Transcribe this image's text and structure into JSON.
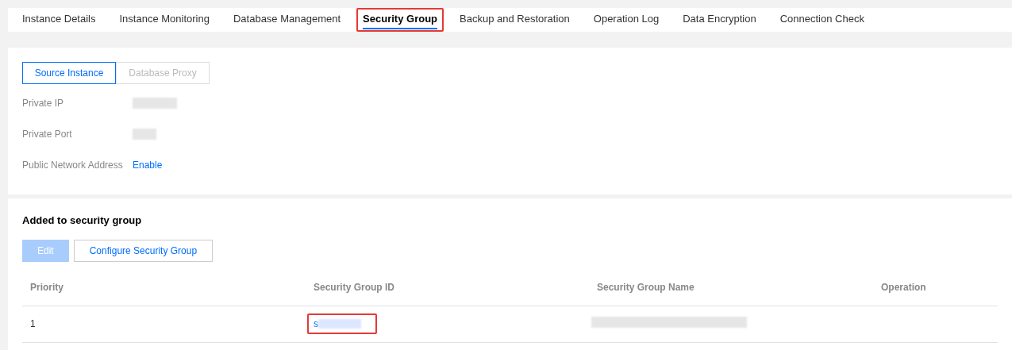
{
  "tabs": [
    {
      "label": "Instance Details",
      "selected": false,
      "highlighted": false
    },
    {
      "label": "Instance Monitoring",
      "selected": false,
      "highlighted": false
    },
    {
      "label": "Database Management",
      "selected": false,
      "highlighted": false
    },
    {
      "label": "Security Group",
      "selected": true,
      "highlighted": true
    },
    {
      "label": "Backup and Restoration",
      "selected": false,
      "highlighted": false
    },
    {
      "label": "Operation Log",
      "selected": false,
      "highlighted": false
    },
    {
      "label": "Data Encryption",
      "selected": false,
      "highlighted": false
    },
    {
      "label": "Connection Check",
      "selected": false,
      "highlighted": false
    }
  ],
  "segments": [
    {
      "label": "Source Instance",
      "selected": true
    },
    {
      "label": "Database Proxy",
      "selected": false
    }
  ],
  "fields": [
    {
      "label": "Private IP",
      "kind": "redacted"
    },
    {
      "label": "Private Port",
      "kind": "redacted"
    },
    {
      "label": "Public Network Address",
      "kind": "link",
      "value": "Enable"
    }
  ],
  "section_title": "Added to security group",
  "buttons": [
    {
      "label": "Edit",
      "disabled": true
    },
    {
      "label": "Configure Security Group",
      "disabled": false
    }
  ],
  "table": {
    "columns": [
      "Priority",
      "Security Group ID",
      "Security Group Name",
      "Operation"
    ],
    "rows": [
      {
        "priority": "1",
        "id": "s",
        "id_highlighted": true
      }
    ]
  }
}
